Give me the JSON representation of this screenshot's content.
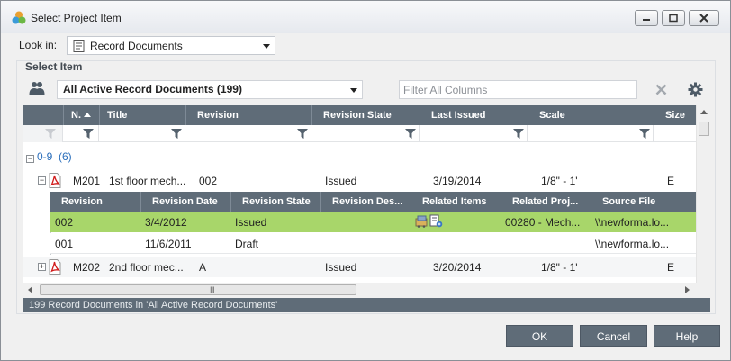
{
  "window": {
    "title": "Select Project Item"
  },
  "look_in": {
    "label": "Look in:",
    "value": "Record Documents"
  },
  "section": {
    "label": "Select Item"
  },
  "view": {
    "selected": "All Active Record Documents (199)"
  },
  "filter": {
    "placeholder": "Filter All Columns"
  },
  "grid": {
    "columns": [
      "N.",
      "Title",
      "Revision",
      "Revision State",
      "Last Issued",
      "Scale",
      "Size"
    ],
    "group": {
      "label": "0-9",
      "count": "(6)",
      "collapse_glyph": "−"
    },
    "rows": [
      {
        "number": "M201",
        "title": "1st floor mech...",
        "revision": "002",
        "state": "Issued",
        "last_issued": "3/19/2014",
        "scale": "1/8\" - 1'",
        "size": "E",
        "expander": "−"
      },
      {
        "number": "M202",
        "title": "2nd floor mec...",
        "revision": "A",
        "state": "Issued",
        "last_issued": "3/20/2014",
        "scale": "1/8\" - 1'",
        "size": "E",
        "expander": "+"
      }
    ],
    "revisions": {
      "columns": [
        "Revision",
        "Revision Date",
        "Revision State",
        "Revision Des...",
        "Related Items",
        "Related Proj...",
        "Source File"
      ],
      "rows": [
        {
          "revision": "002",
          "date": "3/4/2012",
          "state": "Issued",
          "description": "",
          "related_project": "00280 - Mech...",
          "source": "\\\\newforma.lo..."
        },
        {
          "revision": "001",
          "date": "11/6/2011",
          "state": "Draft",
          "description": "",
          "related_project": "",
          "source": "\\\\newforma.lo..."
        }
      ]
    },
    "hscroll_grip": "III"
  },
  "status": {
    "text": "199 Record Documents in 'All Active Record Documents'"
  },
  "buttons": {
    "ok": "OK",
    "cancel": "Cancel",
    "help": "Help"
  },
  "colors": {
    "header_bg": "#5f6c78",
    "selected_row": "#a8d66a",
    "group_text": "#2a6ebb"
  },
  "icons": {
    "app": "app-icon",
    "people": "people-icon",
    "clear": "clear-filter-icon",
    "gear": "gear-icon",
    "pdf": "pdf-icon",
    "funnel": "filter-funnel-icon"
  }
}
